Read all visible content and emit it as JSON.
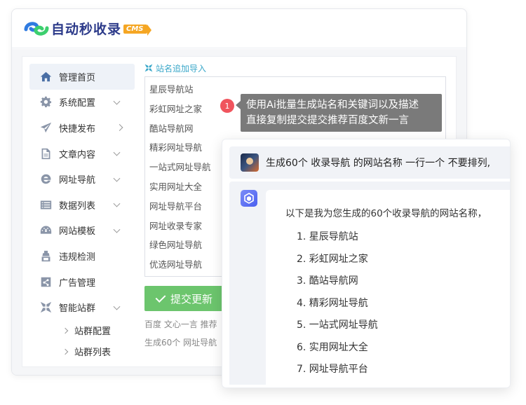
{
  "header": {
    "logo_text": "自动秒收录",
    "badge": "CMS"
  },
  "sidebar": {
    "items": [
      {
        "label": "管理首页",
        "icon": "home-icon",
        "active": true,
        "chevron": "none"
      },
      {
        "label": "系统配置",
        "icon": "gear-icon",
        "chevron": "down"
      },
      {
        "label": "快捷发布",
        "icon": "send-icon",
        "chevron": "right"
      },
      {
        "label": "文章内容",
        "icon": "document-icon",
        "chevron": "down"
      },
      {
        "label": "网址导航",
        "icon": "ie-icon",
        "chevron": "down"
      },
      {
        "label": "数据列表",
        "icon": "list-icon",
        "chevron": "down"
      },
      {
        "label": "网站模板",
        "icon": "dashboard-icon",
        "chevron": "down"
      },
      {
        "label": "违规检测",
        "icon": "inspector-icon",
        "chevron": "none"
      },
      {
        "label": "广告管理",
        "icon": "share-icon",
        "chevron": "none"
      },
      {
        "label": "智能站群",
        "icon": "cluster-icon",
        "chevron": "down"
      }
    ],
    "sub_items": [
      {
        "label": "站群配置"
      },
      {
        "label": "站群列表"
      }
    ]
  },
  "content": {
    "section_label": "站名追加导入",
    "lines": [
      "星辰导航站",
      "彩虹网址之家",
      "酷站导航网",
      "精彩网址导航",
      "一站式网址导航",
      "实用网址大全",
      "网址导航平台",
      "网址收录专家",
      "绿色网址导航",
      "优选网址导航"
    ],
    "submit_label": "提交更新",
    "hint1": "百度 文心一言 推荐",
    "hint2": "生成60个 网址导航"
  },
  "tooltip": {
    "number": "1",
    "line1": "使用Ai批量生成站名和关键词以及描述",
    "line2": "直接复制提交提交推荐百度文新一言"
  },
  "chat": {
    "user_message": "生成60个 收录导航 的网站名称 一行一个 不要排列,",
    "bot_intro": "以下是我为您生成的60个收录导航的网站名称，",
    "bot_list": [
      "1. 星辰导航站",
      "2. 彩虹网址之家",
      "3. 酷站导航网",
      "4. 精彩网址导航",
      "5. 一站式网址导航",
      "6. 实用网址大全",
      "7. 网址导航平台"
    ]
  },
  "colors": {
    "accent": "#3aa7c9",
    "submit": "#6cc56d",
    "badge": "#f0545d",
    "tooltip": "#7a7a7a",
    "logo": "#2d3b8a",
    "cms": "#f5a623"
  }
}
